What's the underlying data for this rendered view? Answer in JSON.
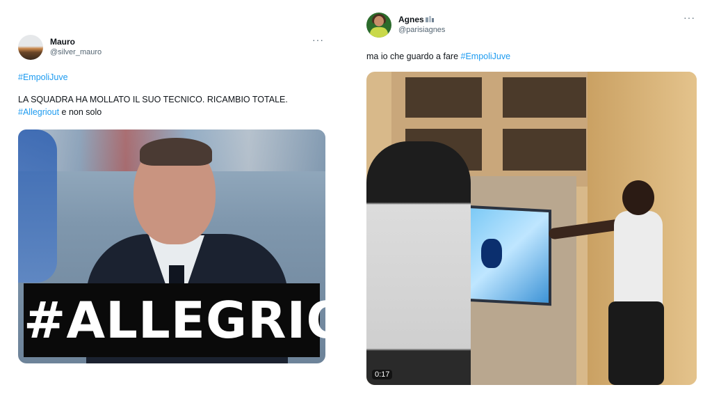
{
  "tweets": [
    {
      "author": {
        "display_name": "Mauro",
        "handle": "@silver_mauro"
      },
      "hashtag": "#EmpoliJuve",
      "text_line1": "LA SQUADRA HA MOLLATO IL SUO TECNICO. RICAMBIO TOTALE.",
      "text_hashtag": "#Allegriout",
      "text_rest": " e non solo",
      "media": {
        "banner_text": "#ALLEGRIOUT"
      }
    },
    {
      "author": {
        "display_name": "Agnes",
        "handle": "@parisiagnes"
      },
      "text": "ma io che guardo a fare ",
      "text_hashtag": "#EmpoliJuve",
      "media": {
        "video_timestamp": "0:17"
      }
    }
  ],
  "icons": {
    "more": "more-horizontal-icon",
    "verified": "verified-badge-icon"
  },
  "colors": {
    "hashtag": "#1d9bf0",
    "text": "#0f1419",
    "secondary": "#536471"
  }
}
